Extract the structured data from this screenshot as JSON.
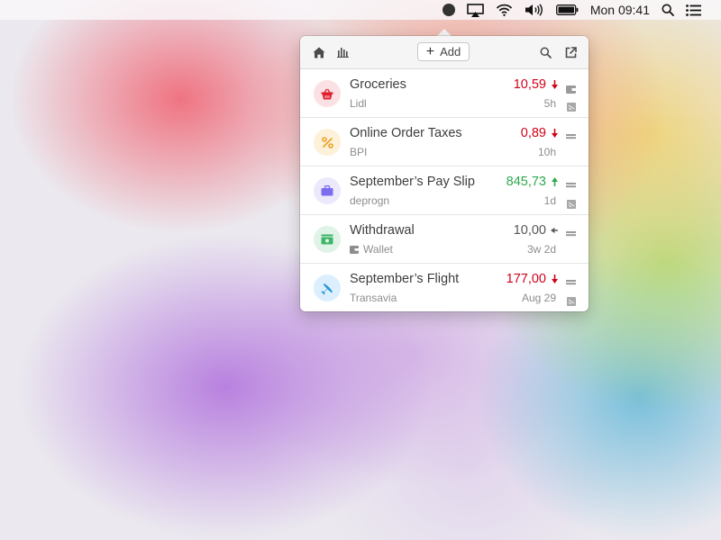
{
  "menubar": {
    "items": [
      {
        "icon": "app-status-icon"
      },
      {
        "icon": "airplay-icon"
      },
      {
        "icon": "wifi-icon"
      },
      {
        "icon": "volume-icon"
      },
      {
        "icon": "battery-icon"
      }
    ],
    "clock": "Mon 09:41",
    "spotlight_icon": "search-icon",
    "notifications_icon": "list-icon"
  },
  "popover": {
    "toolbar": {
      "home_icon": "home-icon",
      "stats_icon": "bar-chart-icon",
      "add_label": "Add",
      "search_icon": "search-icon",
      "open_icon": "external-link-icon"
    },
    "transactions": [
      {
        "title": "Groceries",
        "payee": "Lidl",
        "amount": "10,59",
        "direction": "out",
        "time": "5h",
        "category_icon": "basket-icon",
        "category_color": "#e0202e",
        "category_bg": "#fbe1e3",
        "amount_color": "#d0021b"
      },
      {
        "title": "Online Order Taxes",
        "payee": "BPI",
        "amount": "0,89",
        "direction": "out",
        "time": "10h",
        "category_icon": "percent-icon",
        "category_color": "#eca22a",
        "category_bg": "#fdf1d9",
        "amount_color": "#d0021b"
      },
      {
        "title": "September’s Pay Slip",
        "payee": "deprogn",
        "amount": "845,73",
        "direction": "in",
        "time": "1d",
        "category_icon": "briefcase-icon",
        "category_color": "#7b6cf0",
        "category_bg": "#ece9fc",
        "amount_color": "#2fa84f"
      },
      {
        "title": "Withdrawal",
        "payee": "Wallet",
        "amount": "10,00",
        "direction": "transfer",
        "time": "3w 2d",
        "category_icon": "cash-icon",
        "category_color": "#3fb56a",
        "category_bg": "#e0f3e7",
        "amount_color": "#555555"
      },
      {
        "title": "September’s Flight",
        "payee": "Transavia",
        "amount": "177,00",
        "direction": "out",
        "time": "Aug 29",
        "category_icon": "plane-icon",
        "category_color": "#2b95d6",
        "category_bg": "#dcefff",
        "amount_color": "#d0021b"
      }
    ]
  }
}
